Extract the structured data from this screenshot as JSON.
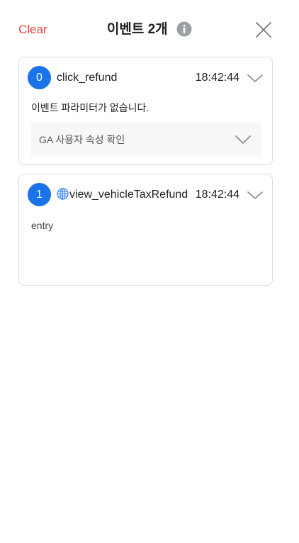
{
  "header": {
    "clear_label": "Clear",
    "title": "이벤트 2개",
    "info_icon": "info-icon",
    "close_icon": "close-icon"
  },
  "events": [
    {
      "index": "0",
      "name": "click_refund",
      "time": "18:42:44",
      "message": "이벤트 파라미터가 없습니다.",
      "ga_section_label": "GA 사용자 속성 확인"
    },
    {
      "index": "1",
      "name": "view_vehicleTaxRefund",
      "name_icon": "globe-icon",
      "time": "18:42:44",
      "message": "entry"
    }
  ],
  "colors": {
    "accent": "#1a73e8",
    "clear": "#e5483f",
    "border": "#dcdcdc",
    "panel_bg": "#f6f7f9"
  }
}
